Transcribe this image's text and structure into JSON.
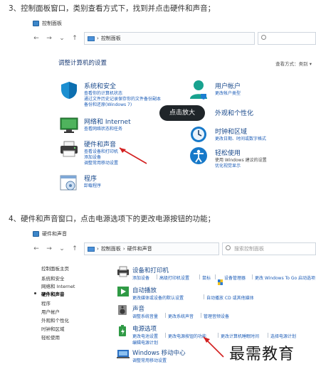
{
  "steps": {
    "step3": "3、控制面板窗口，类别查看方式下，找到并点击硬件和声音；",
    "step4": "4、硬件和声音窗口，点击电源选项下的更改电源按钮的功能；"
  },
  "window1": {
    "title": "控制面板",
    "nav": {
      "back": "←",
      "forward": "→",
      "down": "⌄",
      "up": "↑"
    },
    "address": "控制面板",
    "address_sep": "›",
    "page_title": "调整计算机的设置",
    "view_by": "查看方式：类别 ▾",
    "categories": {
      "system": {
        "title": "系统和安全",
        "links": [
          "查看你的计算机状态",
          "通过文件历史记录保存你的文件备份副本",
          "备份和还原(Windows 7)"
        ]
      },
      "network": {
        "title": "网络和 Internet",
        "links": [
          "查看网络状态和任务"
        ]
      },
      "hardware": {
        "title": "硬件和声音",
        "links": [
          "查看设备和打印机",
          "添加设备",
          "调整常用移动设置"
        ]
      },
      "programs": {
        "title": "程序",
        "links": [
          "卸载程序"
        ]
      },
      "user": {
        "title": "用户帐户",
        "links": [
          "更改帐户类型"
        ]
      },
      "appearance": {
        "title": "外观和个性化"
      },
      "clock": {
        "title": "时钟和区域",
        "links": [
          "更改日期、时间或数字格式"
        ]
      },
      "ease": {
        "title": "轻松使用",
        "text": "使用 Windows 建议的设置",
        "links": [
          "优化视觉显示"
        ]
      }
    },
    "bubble": "点击放大"
  },
  "window2": {
    "title": "硬件和声音",
    "nav": {
      "back": "←",
      "forward": "→",
      "down": "⌄",
      "up": "↑"
    },
    "address": [
      "控制面板",
      "硬件和声音"
    ],
    "address_sep": "›",
    "search_placeholder": "搜索控制面板",
    "sidebar": [
      "控制面板主页",
      "系统和安全",
      "网络和 Internet",
      "硬件和声音",
      "程序",
      "用户帐户",
      "外观和个性化",
      "时钟和区域",
      "轻松使用"
    ],
    "sections": {
      "devices": {
        "title": "设备和打印机",
        "links": [
          "添加设备",
          "高级打印机设置",
          "鼠标",
          "设备管理器",
          "更改 Windows To Go 启动选项"
        ]
      },
      "autoplay": {
        "title": "自动播放",
        "links": [
          "更改媒体或设备的默认设置",
          "自动播放 CD 或其他媒体"
        ]
      },
      "sound": {
        "title": "声音",
        "links": [
          "调整系统音量",
          "更改系统声音",
          "管理音频设备"
        ]
      },
      "power": {
        "title": "电源选项",
        "links": [
          "更改电池设置",
          "更改电源按钮的功能",
          "更改计算机睡眠时间",
          "选择电源计划",
          "编辑电源计划"
        ]
      },
      "mobility": {
        "title": "Windows 移动中心",
        "links": [
          "调整常用移动设置"
        ]
      }
    }
  },
  "watermark": "最需教育",
  "colors": {
    "link": "#1d5db7",
    "title": "#1a4a8c",
    "arrow": "#d32020",
    "bubble": "#1f2529"
  }
}
